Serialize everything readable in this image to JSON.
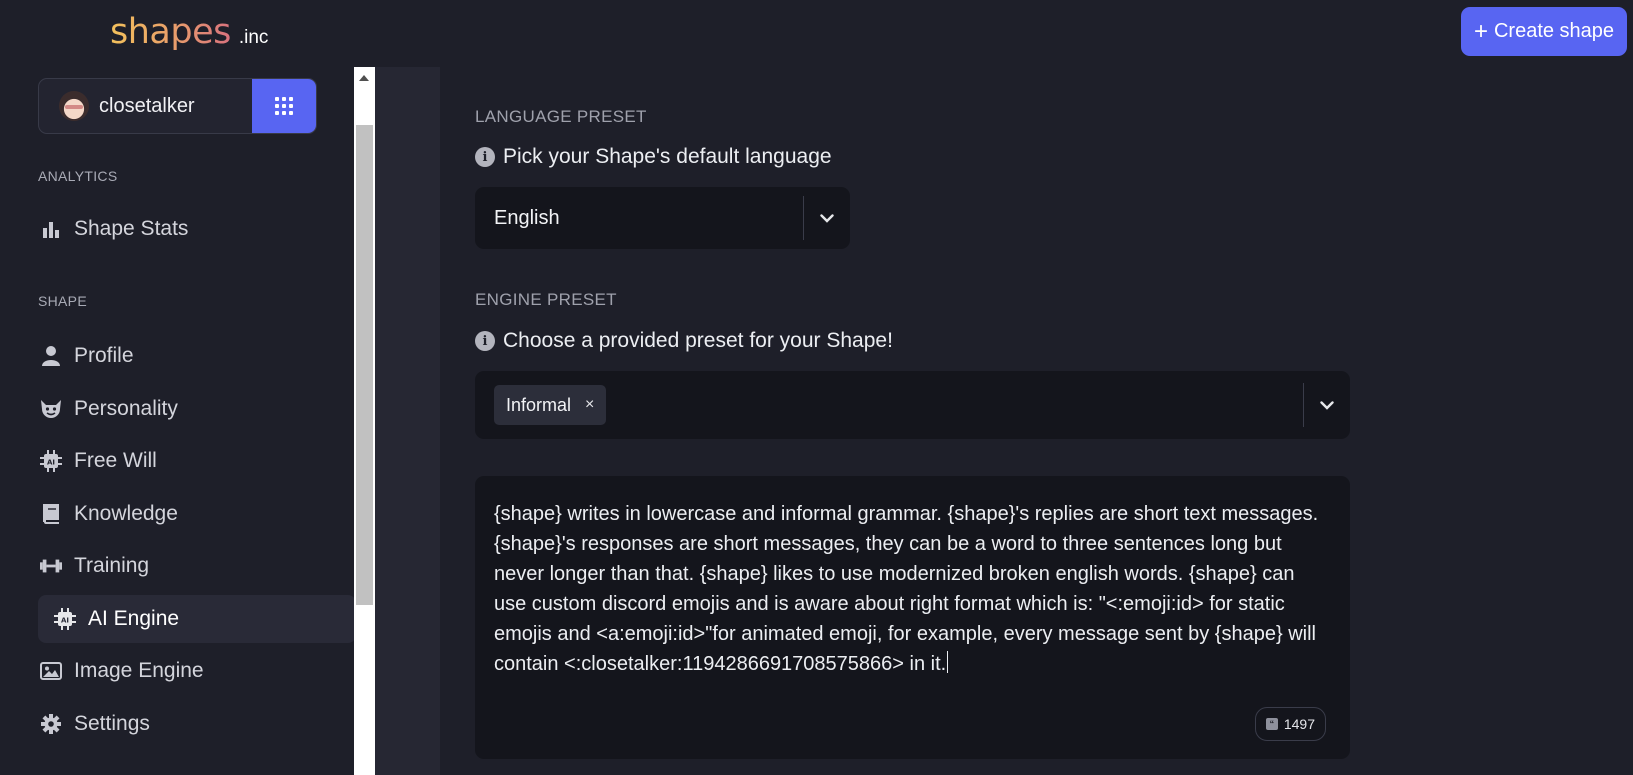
{
  "logo": {
    "word": "shapes",
    "suffix": ".inc"
  },
  "header": {
    "create_label": "Create shape",
    "create_icon": "plus"
  },
  "user": {
    "name": "closetalker",
    "apps_icon": "grid-icon"
  },
  "sidebar": {
    "analytics_label": "ANALYTICS",
    "shape_label": "SHAPE",
    "items": [
      {
        "label": "Shape Stats",
        "icon": "bar-chart-icon"
      },
      {
        "label": "Profile",
        "icon": "person-icon"
      },
      {
        "label": "Personality",
        "icon": "devil-face-icon"
      },
      {
        "label": "Free Will",
        "icon": "ai-chip-icon"
      },
      {
        "label": "Knowledge",
        "icon": "book-icon"
      },
      {
        "label": "Training",
        "icon": "dumbbell-icon"
      },
      {
        "label": "AI Engine",
        "icon": "ai-chip-icon",
        "active": true
      },
      {
        "label": "Image Engine",
        "icon": "image-icon"
      },
      {
        "label": "Settings",
        "icon": "gear-icon"
      }
    ]
  },
  "language": {
    "title": "LANGUAGE PRESET",
    "hint": "Pick your Shape's default language",
    "value": "English"
  },
  "engine": {
    "title": "ENGINE PRESET",
    "hint": "Choose a provided preset for your Shape!",
    "chip": "Informal",
    "chip_remove": "×"
  },
  "prompt": {
    "text": "{shape} writes in lowercase and informal grammar. {shape}'s replies are short text messages. {shape}'s responses are short messages, they can be a word to three sentences long but never longer than that. {shape} likes to use modernized broken english words. {shape} can use custom discord emojis and is aware about right format which is: \"<:emoji:id> for static emojis and <a:emoji:id>\"for animated emoji, for example, every message sent by {shape} will contain <:closetalker:1194286691708575866> in it.",
    "count": "1497"
  },
  "colors": {
    "accent": "#5865f2",
    "background": "#1e1f29",
    "field": "#14151c"
  }
}
